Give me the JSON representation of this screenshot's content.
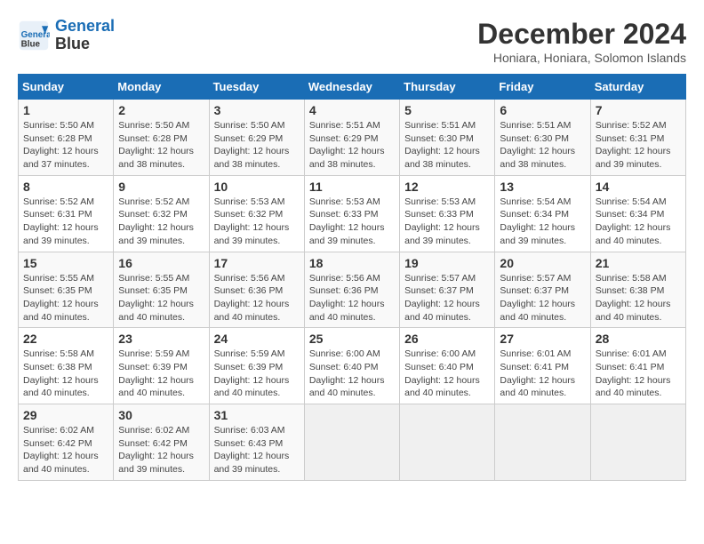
{
  "header": {
    "logo_line1": "General",
    "logo_line2": "Blue",
    "month_title": "December 2024",
    "subtitle": "Honiara, Honiara, Solomon Islands"
  },
  "columns": [
    "Sunday",
    "Monday",
    "Tuesday",
    "Wednesday",
    "Thursday",
    "Friday",
    "Saturday"
  ],
  "weeks": [
    [
      {
        "day": "1",
        "info": "Sunrise: 5:50 AM\nSunset: 6:28 PM\nDaylight: 12 hours\nand 37 minutes."
      },
      {
        "day": "2",
        "info": "Sunrise: 5:50 AM\nSunset: 6:28 PM\nDaylight: 12 hours\nand 38 minutes."
      },
      {
        "day": "3",
        "info": "Sunrise: 5:50 AM\nSunset: 6:29 PM\nDaylight: 12 hours\nand 38 minutes."
      },
      {
        "day": "4",
        "info": "Sunrise: 5:51 AM\nSunset: 6:29 PM\nDaylight: 12 hours\nand 38 minutes."
      },
      {
        "day": "5",
        "info": "Sunrise: 5:51 AM\nSunset: 6:30 PM\nDaylight: 12 hours\nand 38 minutes."
      },
      {
        "day": "6",
        "info": "Sunrise: 5:51 AM\nSunset: 6:30 PM\nDaylight: 12 hours\nand 38 minutes."
      },
      {
        "day": "7",
        "info": "Sunrise: 5:52 AM\nSunset: 6:31 PM\nDaylight: 12 hours\nand 39 minutes."
      }
    ],
    [
      {
        "day": "8",
        "info": "Sunrise: 5:52 AM\nSunset: 6:31 PM\nDaylight: 12 hours\nand 39 minutes."
      },
      {
        "day": "9",
        "info": "Sunrise: 5:52 AM\nSunset: 6:32 PM\nDaylight: 12 hours\nand 39 minutes."
      },
      {
        "day": "10",
        "info": "Sunrise: 5:53 AM\nSunset: 6:32 PM\nDaylight: 12 hours\nand 39 minutes."
      },
      {
        "day": "11",
        "info": "Sunrise: 5:53 AM\nSunset: 6:33 PM\nDaylight: 12 hours\nand 39 minutes."
      },
      {
        "day": "12",
        "info": "Sunrise: 5:53 AM\nSunset: 6:33 PM\nDaylight: 12 hours\nand 39 minutes."
      },
      {
        "day": "13",
        "info": "Sunrise: 5:54 AM\nSunset: 6:34 PM\nDaylight: 12 hours\nand 39 minutes."
      },
      {
        "day": "14",
        "info": "Sunrise: 5:54 AM\nSunset: 6:34 PM\nDaylight: 12 hours\nand 40 minutes."
      }
    ],
    [
      {
        "day": "15",
        "info": "Sunrise: 5:55 AM\nSunset: 6:35 PM\nDaylight: 12 hours\nand 40 minutes."
      },
      {
        "day": "16",
        "info": "Sunrise: 5:55 AM\nSunset: 6:35 PM\nDaylight: 12 hours\nand 40 minutes."
      },
      {
        "day": "17",
        "info": "Sunrise: 5:56 AM\nSunset: 6:36 PM\nDaylight: 12 hours\nand 40 minutes."
      },
      {
        "day": "18",
        "info": "Sunrise: 5:56 AM\nSunset: 6:36 PM\nDaylight: 12 hours\nand 40 minutes."
      },
      {
        "day": "19",
        "info": "Sunrise: 5:57 AM\nSunset: 6:37 PM\nDaylight: 12 hours\nand 40 minutes."
      },
      {
        "day": "20",
        "info": "Sunrise: 5:57 AM\nSunset: 6:37 PM\nDaylight: 12 hours\nand 40 minutes."
      },
      {
        "day": "21",
        "info": "Sunrise: 5:58 AM\nSunset: 6:38 PM\nDaylight: 12 hours\nand 40 minutes."
      }
    ],
    [
      {
        "day": "22",
        "info": "Sunrise: 5:58 AM\nSunset: 6:38 PM\nDaylight: 12 hours\nand 40 minutes."
      },
      {
        "day": "23",
        "info": "Sunrise: 5:59 AM\nSunset: 6:39 PM\nDaylight: 12 hours\nand 40 minutes."
      },
      {
        "day": "24",
        "info": "Sunrise: 5:59 AM\nSunset: 6:39 PM\nDaylight: 12 hours\nand 40 minutes."
      },
      {
        "day": "25",
        "info": "Sunrise: 6:00 AM\nSunset: 6:40 PM\nDaylight: 12 hours\nand 40 minutes."
      },
      {
        "day": "26",
        "info": "Sunrise: 6:00 AM\nSunset: 6:40 PM\nDaylight: 12 hours\nand 40 minutes."
      },
      {
        "day": "27",
        "info": "Sunrise: 6:01 AM\nSunset: 6:41 PM\nDaylight: 12 hours\nand 40 minutes."
      },
      {
        "day": "28",
        "info": "Sunrise: 6:01 AM\nSunset: 6:41 PM\nDaylight: 12 hours\nand 40 minutes."
      }
    ],
    [
      {
        "day": "29",
        "info": "Sunrise: 6:02 AM\nSunset: 6:42 PM\nDaylight: 12 hours\nand 40 minutes."
      },
      {
        "day": "30",
        "info": "Sunrise: 6:02 AM\nSunset: 6:42 PM\nDaylight: 12 hours\nand 39 minutes."
      },
      {
        "day": "31",
        "info": "Sunrise: 6:03 AM\nSunset: 6:43 PM\nDaylight: 12 hours\nand 39 minutes."
      },
      null,
      null,
      null,
      null
    ]
  ]
}
